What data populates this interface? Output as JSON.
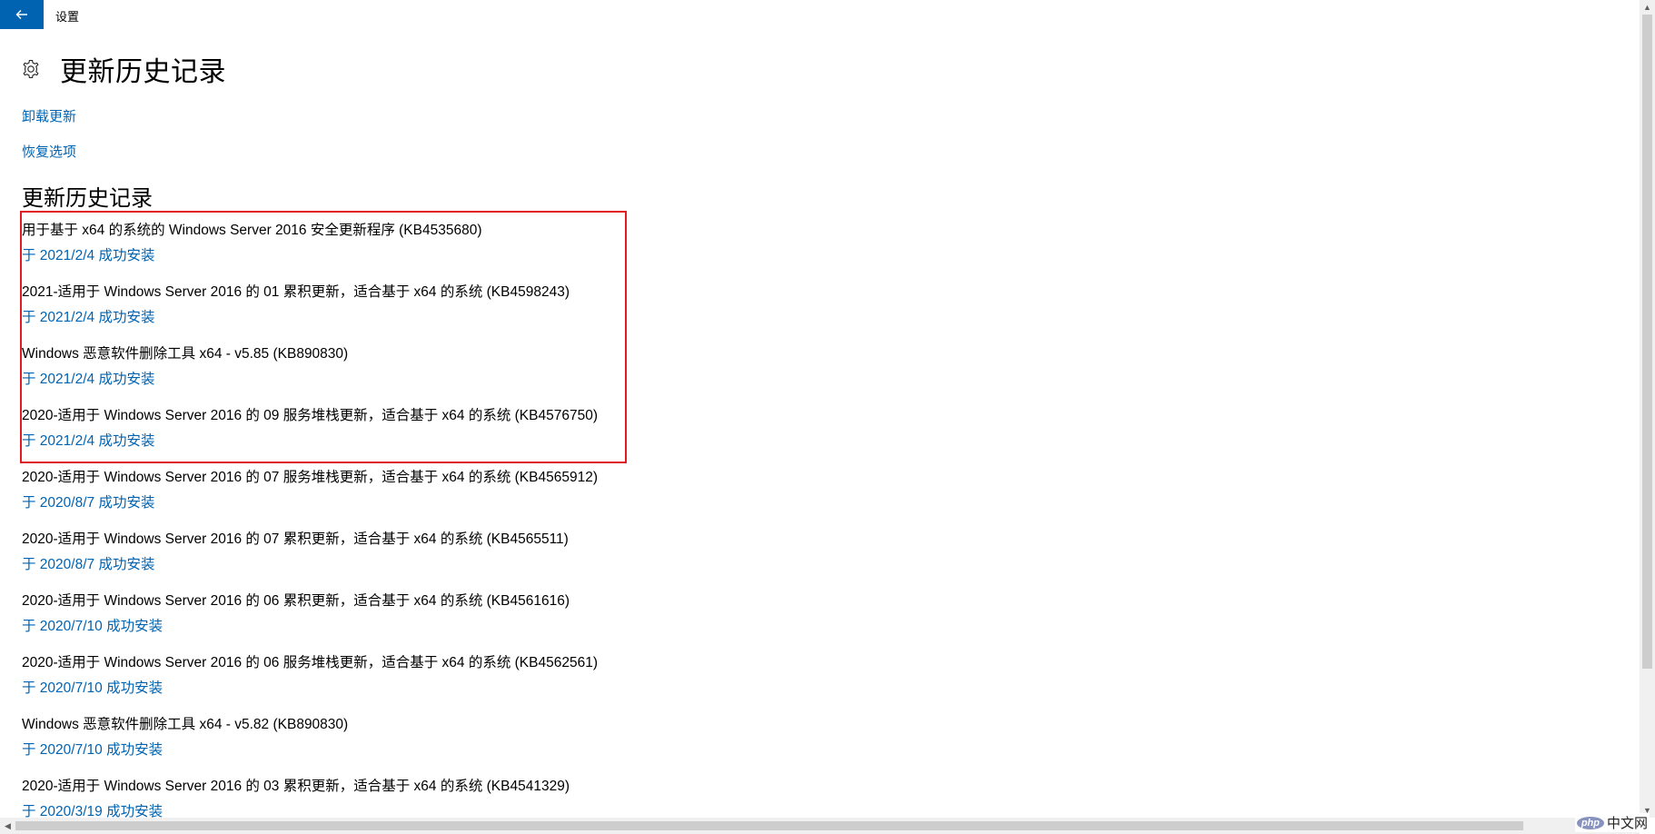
{
  "window": {
    "title": "设置",
    "back_icon": "back-arrow-icon"
  },
  "header": {
    "icon": "gear-icon",
    "title": "更新历史记录"
  },
  "links": {
    "uninstall": "卸载更新",
    "recovery": "恢复选项"
  },
  "section": {
    "title": "更新历史记录"
  },
  "updates": [
    {
      "title": "用于基于 x64 的系统的 Windows Server 2016 安全更新程序 (KB4535680)",
      "status": "于 2021/2/4 成功安装"
    },
    {
      "title": "2021-适用于 Windows Server 2016 的 01 累积更新，适合基于 x64 的系统 (KB4598243)",
      "status": "于 2021/2/4 成功安装"
    },
    {
      "title": "Windows 恶意软件删除工具 x64 - v5.85 (KB890830)",
      "status": "于 2021/2/4 成功安装"
    },
    {
      "title": "2020-适用于 Windows Server 2016 的 09 服务堆栈更新，适合基于 x64 的系统 (KB4576750)",
      "status": "于 2021/2/4 成功安装"
    },
    {
      "title": "2020-适用于 Windows Server 2016 的 07 服务堆栈更新，适合基于 x64 的系统 (KB4565912)",
      "status": "于 2020/8/7 成功安装"
    },
    {
      "title": "2020-适用于 Windows Server 2016 的 07 累积更新，适合基于 x64 的系统 (KB4565511)",
      "status": "于 2020/8/7 成功安装"
    },
    {
      "title": "2020-适用于 Windows Server 2016 的 06 累积更新，适合基于 x64 的系统 (KB4561616)",
      "status": "于 2020/7/10 成功安装"
    },
    {
      "title": "2020-适用于 Windows Server 2016 的 06 服务堆栈更新，适合基于 x64 的系统 (KB4562561)",
      "status": "于 2020/7/10 成功安装"
    },
    {
      "title": "Windows 恶意软件删除工具 x64 - v5.82 (KB890830)",
      "status": "于 2020/7/10 成功安装"
    },
    {
      "title": "2020-适用于 Windows Server 2016 的 03 累积更新，适合基于 x64 的系统 (KB4541329)",
      "status": "于 2020/3/19 成功安装"
    }
  ],
  "watermark": {
    "logo": "php",
    "text": "中文网"
  },
  "colors": {
    "accent": "#0063b1",
    "highlight_border": "#e01b24"
  }
}
